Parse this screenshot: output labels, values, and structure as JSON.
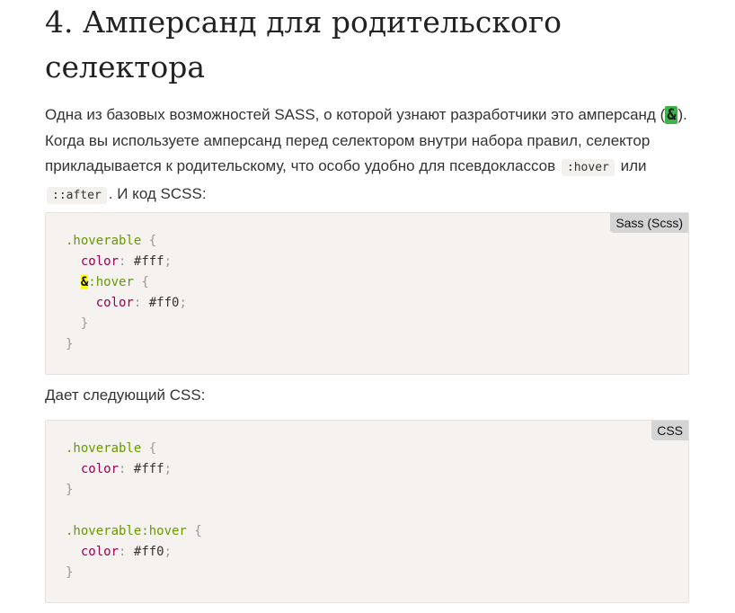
{
  "heading": "4. Амперсанд для родительского селектора",
  "intro": {
    "part1": "Одна из базовых возможностей SASS, о которой узнают разработчики это амперсанд (",
    "amp": "&",
    "part2": "). Когда вы используете амперсанд перед селектором внутри набора правил, селектор прикладывается к родительскому, что особо удобно для псевдоклассов ",
    "code1": ":hover",
    "part3": " или ",
    "code2": "::after",
    "part4": ". И код SCSS:"
  },
  "block1": {
    "language": "Sass (Scss)",
    "lines": {
      "l1_sel": ".hoverable",
      "l1_brace": "{",
      "l2_prop": "color",
      "l2_colon": ":",
      "l2_val": "#fff",
      "l2_semi": ";",
      "l3_amp": "&",
      "l3_sel": ":hover",
      "l3_brace": "{",
      "l4_prop": "color",
      "l4_colon": ":",
      "l4_val": "#ff0",
      "l4_semi": ";",
      "l5_brace": "}",
      "l6_brace": "}"
    }
  },
  "caption": "Дает следующий CSS:",
  "block2": {
    "language": "CSS",
    "lines": {
      "l1_sel": ".hoverable",
      "l1_brace": "{",
      "l2_prop": "color",
      "l2_colon": ":",
      "l2_val": "#fff",
      "l2_semi": ";",
      "l3_brace": "}",
      "l5_sel": ".hoverable:hover",
      "l5_brace": "{",
      "l6_prop": "color",
      "l6_colon": ":",
      "l6_val": "#ff0",
      "l6_semi": ";",
      "l7_brace": "}"
    }
  },
  "colors": {
    "selector": "#669900",
    "property": "#990055",
    "punctuation": "#999999",
    "code_bg": "#f5f2f0",
    "amp_highlight": "#ffff00",
    "inline_amp_bg": "#3cb34a"
  }
}
